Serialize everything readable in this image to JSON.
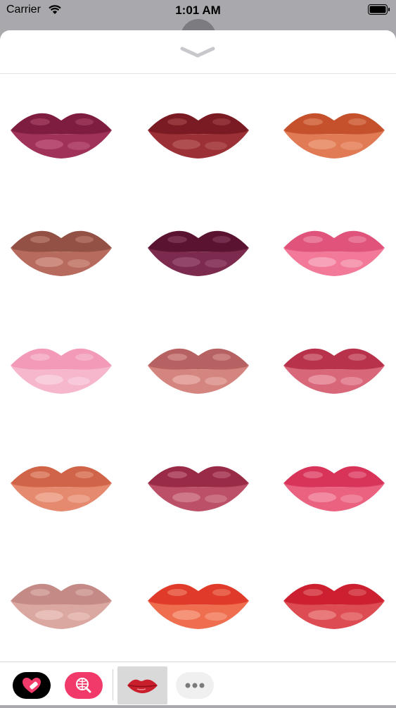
{
  "status_bar": {
    "carrier": "Carrier",
    "time": "1:01 AM",
    "icons": [
      "wifi-icon",
      "battery-icon"
    ]
  },
  "sheet": {
    "collapse_icon": "chevron-down-icon"
  },
  "stickers": [
    {
      "upper": "#7e1d3f",
      "lower": "#a0325a",
      "shine": "#c05a7d"
    },
    {
      "upper": "#7a1a22",
      "lower": "#9b3036",
      "shine": "#b55a5c"
    },
    {
      "upper": "#c4502c",
      "lower": "#e07b55",
      "shine": "#eea080"
    },
    {
      "upper": "#935145",
      "lower": "#b76a5e",
      "shine": "#d49a8c"
    },
    {
      "upper": "#5a1432",
      "lower": "#7c2a4d",
      "shine": "#9b5272"
    },
    {
      "upper": "#e0537a",
      "lower": "#f27a98",
      "shine": "#f7b0c3"
    },
    {
      "upper": "#f29ab8",
      "lower": "#f6b6cc",
      "shine": "#fad5e2"
    },
    {
      "upper": "#b76262",
      "lower": "#d58580",
      "shine": "#e8b1aa"
    },
    {
      "upper": "#b7324a",
      "lower": "#d9677a",
      "shine": "#eca0ad"
    },
    {
      "upper": "#d06448",
      "lower": "#e58a6f",
      "shine": "#f1b39f"
    },
    {
      "upper": "#9a2b47",
      "lower": "#bb5068",
      "shine": "#d58596"
    },
    {
      "upper": "#d8345a",
      "lower": "#ea6280",
      "shine": "#f499ad"
    },
    {
      "upper": "#c48a86",
      "lower": "#dba7a1",
      "shine": "#ecc8c2"
    },
    {
      "upper": "#e03b2a",
      "lower": "#ef6e50",
      "shine": "#f6a287"
    },
    {
      "upper": "#cc2030",
      "lower": "#dd4c52",
      "shine": "#ec8a8a"
    }
  ],
  "tray": {
    "items": [
      {
        "name": "app-store-button",
        "icon": "heart-store-icon",
        "color": "#000000"
      },
      {
        "name": "image-search-button",
        "icon": "globe-search-icon",
        "color": "#f23a6a"
      },
      {
        "name": "current-app-button",
        "icon": "lips-icon",
        "color": "#d9d9d9"
      },
      {
        "name": "more-apps-button",
        "icon": "ellipsis-icon",
        "color": "#f0f0f0"
      }
    ]
  }
}
